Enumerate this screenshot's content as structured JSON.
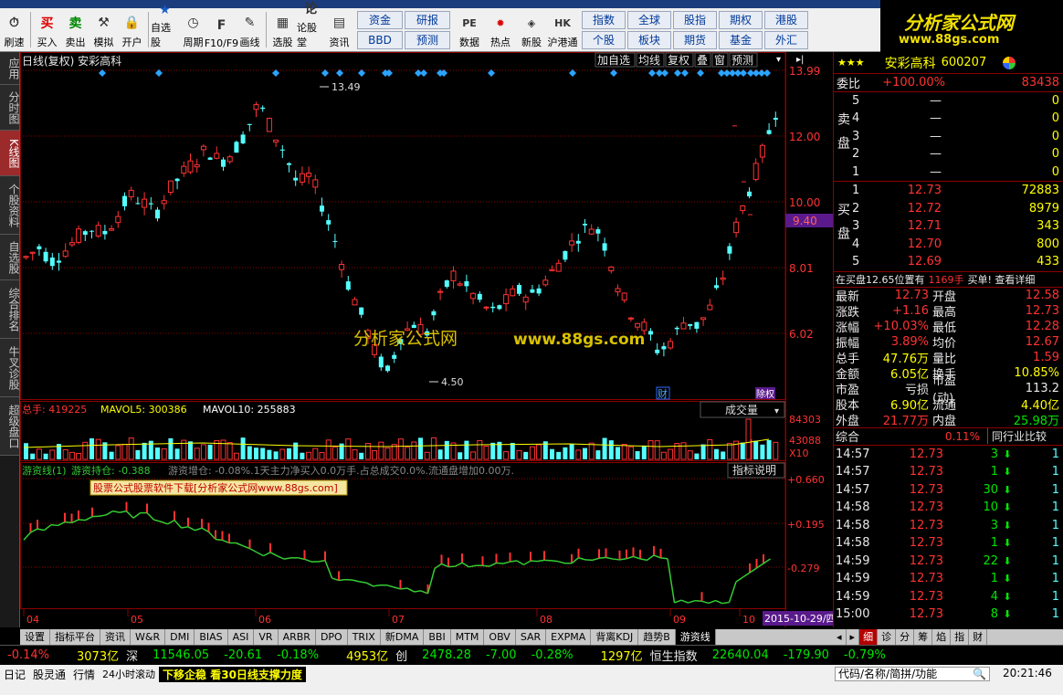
{
  "toolbar": {
    "buttons": [
      {
        "label": "刷速",
        "icon": "refresh-icon"
      },
      {
        "label": "买入",
        "icon": "buy-icon"
      },
      {
        "label": "卖出",
        "icon": "sell-icon"
      },
      {
        "label": "模拟",
        "icon": "hammer-icon"
      },
      {
        "label": "开户",
        "icon": "lock-icon"
      },
      {
        "label": "自选股",
        "icon": "star-icon"
      },
      {
        "label": "周期",
        "icon": "clock-icon"
      },
      {
        "label": "F10/F9",
        "icon": "f10-icon"
      },
      {
        "label": "画线",
        "icon": "pen-icon"
      },
      {
        "label": "选股",
        "icon": "select-icon"
      },
      {
        "label": "论股堂",
        "icon": "forum-icon"
      },
      {
        "label": "资讯",
        "icon": "news-icon"
      }
    ],
    "grid1": [
      "资金",
      "研报",
      "BBD",
      "预测"
    ],
    "buttons2": [
      {
        "label": "数据",
        "icon": "pe-icon"
      },
      {
        "label": "热点",
        "icon": "hot-icon"
      },
      {
        "label": "新股",
        "icon": "newstock-icon"
      },
      {
        "label": "沪港通",
        "icon": "hk-icon"
      }
    ],
    "grid2": [
      "指数",
      "全球",
      "股指",
      "期权",
      "港股",
      "个股",
      "板块",
      "期货",
      "基金",
      "外汇"
    ]
  },
  "logo": {
    "title": "分析家公式网",
    "url": "www.88gs.com"
  },
  "left_nav": [
    "应用",
    "分时图",
    "K线图",
    "个股资料",
    "自选股",
    "综合排名",
    "牛叉诊股",
    "超级盘口"
  ],
  "left_nav_active": 2,
  "chart": {
    "header": "日线(复权) 安彩高科",
    "header_buttons": [
      "加自选",
      "均线",
      "复权",
      "叠",
      "窗",
      "预测"
    ],
    "price_axis": [
      "13.99",
      "12.00",
      "10.00",
      "9.40",
      "8.01",
      "6.02"
    ],
    "high_label": "13.49",
    "low_label": "4.50",
    "watermark_cn": "分析家公式网",
    "watermark_url": "www.88gs.com",
    "tag_cai": "财",
    "tag_chi": "除权",
    "vol_legend": {
      "total": "总手: 419225",
      "ma5": "MAVOL5: 300386",
      "ma10": "MAVOL10: 255883"
    },
    "vol_button": "成交量",
    "vol_axis": [
      "84303",
      "43088",
      "X10"
    ],
    "ind_legend": {
      "name": "游资线(1)",
      "v1": "游资持仓: -0.388",
      "v2": "游资增仓: -0.08%.1天主力净买入0.0万手.占总成交0.0%.流通盘增加0.00万."
    },
    "ind_button": "指标说明",
    "ad_banner": "股票公式股票软件下载[分析家公式网www.88gs.com]",
    "ind_axis": [
      "+0.660",
      "+0.195",
      "-0.279"
    ],
    "x_labels": [
      "04",
      "05",
      "06",
      "07",
      "08",
      "09",
      "10"
    ],
    "date_box": "2015-10-29/四"
  },
  "quote": {
    "stock_name": "安彩高科",
    "code": "600207",
    "weibi_label": "委比",
    "weibi": "+100.00%",
    "weicha": "83438",
    "sell_label": "卖盘",
    "buy_label": "买盘",
    "sells": [
      {
        "n": "5",
        "p": "—",
        "v": "0"
      },
      {
        "n": "4",
        "p": "—",
        "v": "0"
      },
      {
        "n": "3",
        "p": "—",
        "v": "0"
      },
      {
        "n": "2",
        "p": "—",
        "v": "0"
      },
      {
        "n": "1",
        "p": "—",
        "v": "0"
      }
    ],
    "buys": [
      {
        "n": "1",
        "p": "12.73",
        "v": "72883"
      },
      {
        "n": "2",
        "p": "12.72",
        "v": "8979"
      },
      {
        "n": "3",
        "p": "12.71",
        "v": "343"
      },
      {
        "n": "4",
        "p": "12.70",
        "v": "800"
      },
      {
        "n": "5",
        "p": "12.69",
        "v": "433"
      }
    ],
    "info_left": "在买盘12.65位置有",
    "info_mid": "1169手",
    "info_right": "买单! 查看详细",
    "stats": [
      [
        "最新",
        "12.73",
        "开盘",
        "12.58"
      ],
      [
        "涨跌",
        "+1.16",
        "最高",
        "12.73"
      ],
      [
        "涨幅",
        "+10.03%",
        "最低",
        "12.28"
      ],
      [
        "振幅",
        "3.89%",
        "均价",
        "12.67"
      ],
      [
        "总手",
        "47.76万",
        "量比",
        "1.59"
      ],
      [
        "金额",
        "6.05亿",
        "换手",
        "10.85%"
      ],
      [
        "市盈",
        "亏损",
        "市盈(动)",
        "113.2"
      ],
      [
        "股本",
        "6.90亿",
        "流通",
        "4.40亿"
      ],
      [
        "外盘",
        "21.77万",
        "内盘",
        "25.98万"
      ]
    ],
    "zonghe_label": "综合",
    "zonghe_val": "0.11%",
    "compare": "同行业比较",
    "ticks": [
      [
        "14:57",
        "12.73",
        "3",
        "1"
      ],
      [
        "14:57",
        "12.73",
        "1",
        "1"
      ],
      [
        "14:57",
        "12.73",
        "30",
        "1"
      ],
      [
        "14:58",
        "12.73",
        "10",
        "1"
      ],
      [
        "14:58",
        "12.73",
        "3",
        "1"
      ],
      [
        "14:58",
        "12.73",
        "1",
        "1"
      ],
      [
        "14:59",
        "12.73",
        "22",
        "1"
      ],
      [
        "14:59",
        "12.73",
        "1",
        "1"
      ],
      [
        "14:59",
        "12.73",
        "4",
        "1"
      ],
      [
        "15:00",
        "12.73",
        "8",
        "1"
      ]
    ]
  },
  "tabs": [
    "设置",
    "指标平台",
    "资讯",
    "W&R",
    "DMI",
    "BIAS",
    "ASI",
    "VR",
    "ARBR",
    "DPO",
    "TRIX",
    "新DMA",
    "BBI",
    "MTM",
    "OBV",
    "SAR",
    "EXPMA",
    "背离KDJ",
    "趋势B",
    "游资线"
  ],
  "tabs_active": 19,
  "rtabs": [
    "细",
    "诊",
    "分",
    "筹",
    "焰",
    "指",
    "财"
  ],
  "status": [
    "-0.14%",
    "3073亿",
    "深",
    "11546.05",
    "-20.61",
    "-0.18%",
    "4953亿",
    "创",
    "2478.28",
    "-7.00",
    "-0.28%",
    "1297亿",
    "恒生指数",
    "22640.04",
    "-179.90",
    "-0.79%"
  ],
  "status2": {
    "items": [
      "日记",
      "股灵通",
      "行情",
      "24小时滚动"
    ],
    "news": "下移企稳 看30日线支撑力度",
    "search": "代码/名称/简拼/功能",
    "time": "20:21:46"
  }
}
